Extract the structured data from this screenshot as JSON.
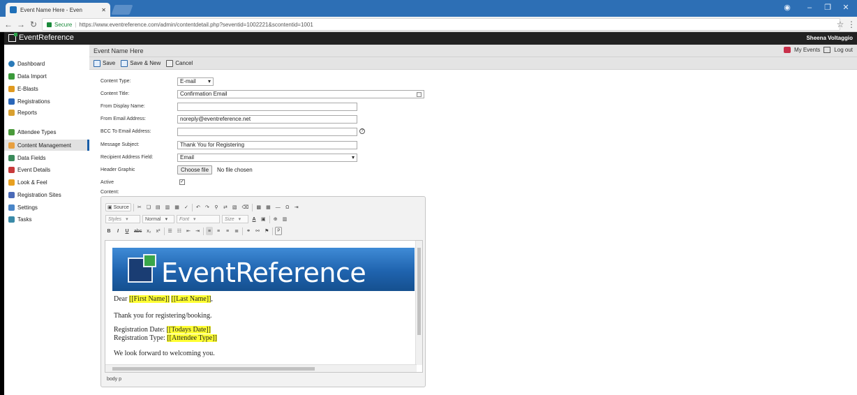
{
  "browser": {
    "tab_title": "Event Name Here - Even",
    "url_secure": "Secure",
    "url": "https://www.eventreference.com/admin/contentdetail.php?seventid=1002221&scontentid=1001"
  },
  "app": {
    "brand": "EventReference",
    "user": "Sheena Voltaggio",
    "page_title": "Event Name Here",
    "my_events": "My Events",
    "log_out": "Log out"
  },
  "toolbar": {
    "save": "Save",
    "save_new": "Save & New",
    "cancel": "Cancel"
  },
  "sidebar": {
    "items": [
      {
        "label": "Dashboard",
        "icon": "dashboard-icon",
        "color": "#2a7ab8"
      },
      {
        "label": "Data Import",
        "icon": "import-icon",
        "color": "#3a9a3a"
      },
      {
        "label": "E-Blasts",
        "icon": "eblast-icon",
        "color": "#e09a20"
      },
      {
        "label": "Registrations",
        "icon": "registrations-icon",
        "color": "#2a66b8"
      },
      {
        "label": "Reports",
        "icon": "reports-icon",
        "color": "#d9a030"
      },
      {
        "label": "Attendee Types",
        "icon": "attendee-types-icon",
        "color": "#4a9a3a"
      },
      {
        "label": "Content Management",
        "icon": "content-icon",
        "color": "#e8a040"
      },
      {
        "label": "Data Fields",
        "icon": "data-fields-icon",
        "color": "#3a8a5a"
      },
      {
        "label": "Event Details",
        "icon": "event-details-icon",
        "color": "#c83a3a"
      },
      {
        "label": "Look & Feel",
        "icon": "look-feel-icon",
        "color": "#e8a020"
      },
      {
        "label": "Registration Sites",
        "icon": "registration-sites-icon",
        "color": "#4a6ab8"
      },
      {
        "label": "Settings",
        "icon": "settings-icon",
        "color": "#4a86c8"
      },
      {
        "label": "Tasks",
        "icon": "tasks-icon",
        "color": "#3a8aa8"
      }
    ]
  },
  "form": {
    "content_type_label": "Content Type:",
    "content_type_value": "E-mail",
    "content_title_label": "Content Title:",
    "content_title_value": "Confirmation Email",
    "from_display_label": "From Display Name:",
    "from_display_value": "",
    "from_email_label": "From Email Address:",
    "from_email_value": "noreply@eventreference.net",
    "bcc_label": "BCC To Email Address:",
    "bcc_value": "",
    "subject_label": "Message Subject:",
    "subject_value": "Thank You for Registering",
    "recipient_label": "Recipient Address Field:",
    "recipient_value": "Email",
    "header_graphic_label": "Header Graphic",
    "choose_file": "Choose file",
    "no_file": "No file chosen",
    "active_label": "Active",
    "active_checked": true,
    "content_label": "Content:"
  },
  "editor": {
    "source": "Source",
    "styles": "Styles",
    "format": "Normal",
    "font": "Font",
    "size": "Size",
    "banner_text": "EventReference",
    "dear": "Dear",
    "first_name": "[[First Name]]",
    "last_name": "[[Last Name]]",
    "thanks": "Thank you for registering/booking.",
    "reg_date_label": "Registration Date:",
    "reg_date_token": "[[Todays Date]]",
    "reg_type_label": "Registration Type:",
    "reg_type_token": "[[Attendee Type]]",
    "forward": "We look forward to welcoming you.",
    "path": "body  p"
  }
}
